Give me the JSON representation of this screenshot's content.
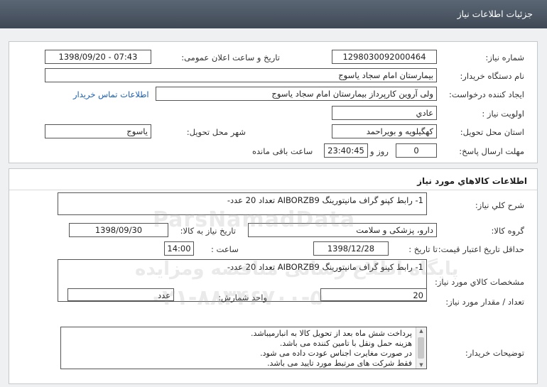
{
  "header": {
    "title": "جزئیات اطلاعات نیاز"
  },
  "need_info": {
    "need_number_label": "شماره نیاز:",
    "need_number": "1298030092000464",
    "announce_label": "تاریخ و ساعت اعلان عمومی:",
    "announce_value": "1398/09/20 - 07:43",
    "buyer_org_label": "نام دستگاه خریدار:",
    "buyer_org": "بیمارستان امام سجاد یاسوج",
    "creator_label": "ایجاد کننده درخواست:",
    "creator": "ولی آروین کارپرداز بیمارستان امام سجاد یاسوج",
    "contact_link": "اطلاعات تماس خریدار",
    "priority_label": "اولویت نیاز :",
    "priority": "عادي",
    "province_label": "استان محل تحویل:",
    "province": "کهگیلویه و بویراحمد",
    "city_label": "شهر محل تحویل:",
    "city": "یاسوج",
    "deadline_label": "مهلت ارسال پاسخ:",
    "days": "0",
    "days_and": "روز و",
    "remaining_time": "23:40:45",
    "remaining_label": "ساعت باقی مانده"
  },
  "goods": {
    "section_title": "اطلاعات کالاهاي مورد نياز",
    "summary_label": "شرح کلي نياز:",
    "summary": "1- رابط کپنو گراف مانیتورینگ AIBORZB9 تعداد 20 عدد-",
    "group_label": "گروه کالا:",
    "group": "دارو، پزشکی و سلامت",
    "need_date_label": "تاریخ نیاز به کالا:",
    "need_date": "1398/09/30",
    "validity_label": "حداقل تاریخ اعتبار قیمت:",
    "until_date_label": "تا تاریخ :",
    "until_date": "1398/12/28",
    "hour_label": "ساعت :",
    "hour": "14:00",
    "specs_label": "مشخصات کالاي مورد نياز:",
    "specs": "1- رابط کپنو گراف مانیتورینگ AIBORZB9 تعداد 20 عدد-",
    "qty_label": "تعداد / مقدار مورد نیاز:",
    "qty": "20",
    "unit_label": "واحد شمارش:",
    "unit": "عدد",
    "buyer_notes_label": "توضیحات خریدار:",
    "buyer_notes": [
      "پرداخت شش ماه بعد از تحویل کالا به انبارمیباشد.",
      "هزینه حمل ونقل با تامین کننده می باشد.",
      "در صورت مغایرت اجناس عودت داده می شود.",
      "فقط شرکت های مرتبط مورد تایید می باشد."
    ]
  },
  "watermark": {
    "brand": "ParsNamadData",
    "line1": "پایگاه اطلاع رسانی مناقصه ومزایده",
    "phone": "۰۲۱-۸۸۳۴۶۷۰۰-۵"
  }
}
